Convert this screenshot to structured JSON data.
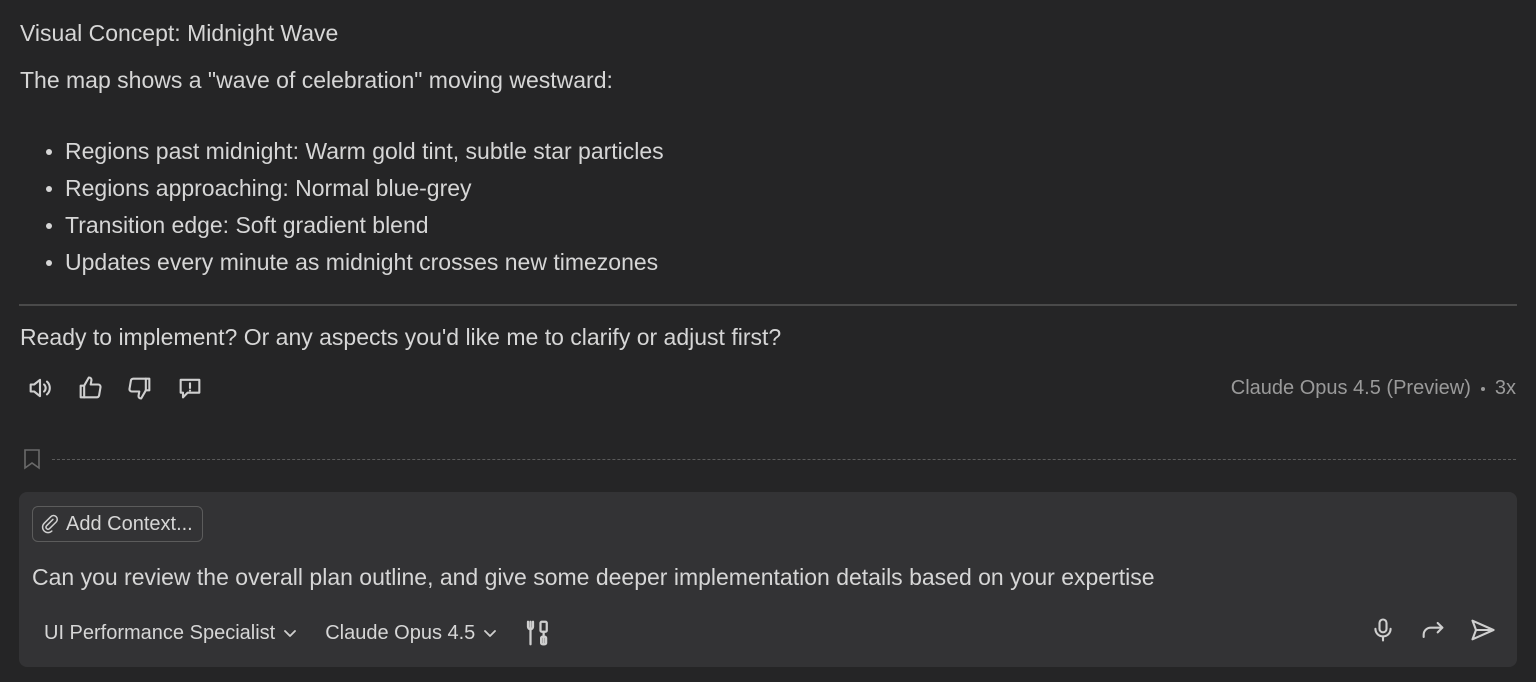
{
  "message": {
    "heading": "Visual Concept: Midnight Wave",
    "intro": "The map shows a \"wave of celebration\" moving westward:",
    "bullets": [
      "Regions past midnight: Warm gold tint, subtle star particles",
      "Regions approaching: Normal blue-grey",
      "Transition edge: Soft gradient blend",
      "Updates every minute as midnight crosses new timezones"
    ],
    "question": "Ready to implement? Or any aspects you'd like me to clarify or adjust first?"
  },
  "actions": {
    "icons": [
      "speaker-icon",
      "thumbs-up-icon",
      "thumbs-down-icon",
      "feedback-icon"
    ]
  },
  "model_meta": {
    "model": "Claude Opus 4.5 (Preview)",
    "multiplier": "3x"
  },
  "composer": {
    "add_context_label": "Add Context...",
    "prompt_text": "Can you review the overall plan outline, and give some deeper implementation details based on your expertise",
    "agent_mode": "UI Performance Specialist",
    "model_select": "Claude Opus 4.5"
  },
  "colors": {
    "background": "#252526",
    "composer": "#333335",
    "text": "#d6d6d6",
    "muted": "#9a9a9a"
  }
}
